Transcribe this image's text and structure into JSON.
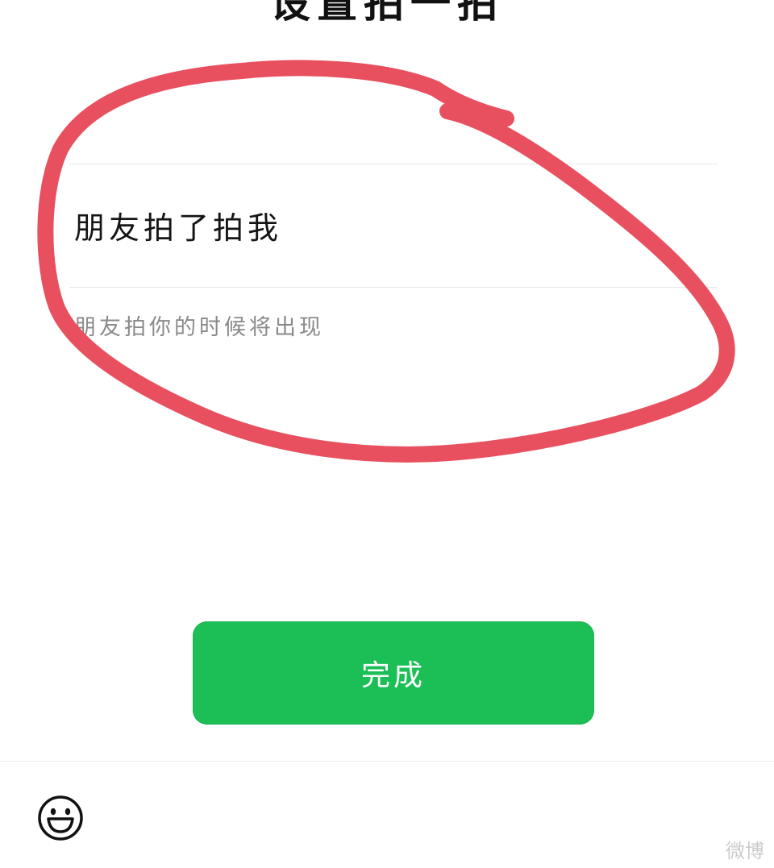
{
  "header": {
    "title": "设置拍一拍"
  },
  "form": {
    "tickle_value": "朋友拍了拍我",
    "hint": "朋友拍你的时候将出现"
  },
  "actions": {
    "done_label": "完成"
  },
  "toolbar": {
    "emoji_icon": "smiley-face-icon"
  },
  "watermark": {
    "text": "微博"
  },
  "colors": {
    "accent": "#1cbf56",
    "annotation": "#e8505f"
  }
}
